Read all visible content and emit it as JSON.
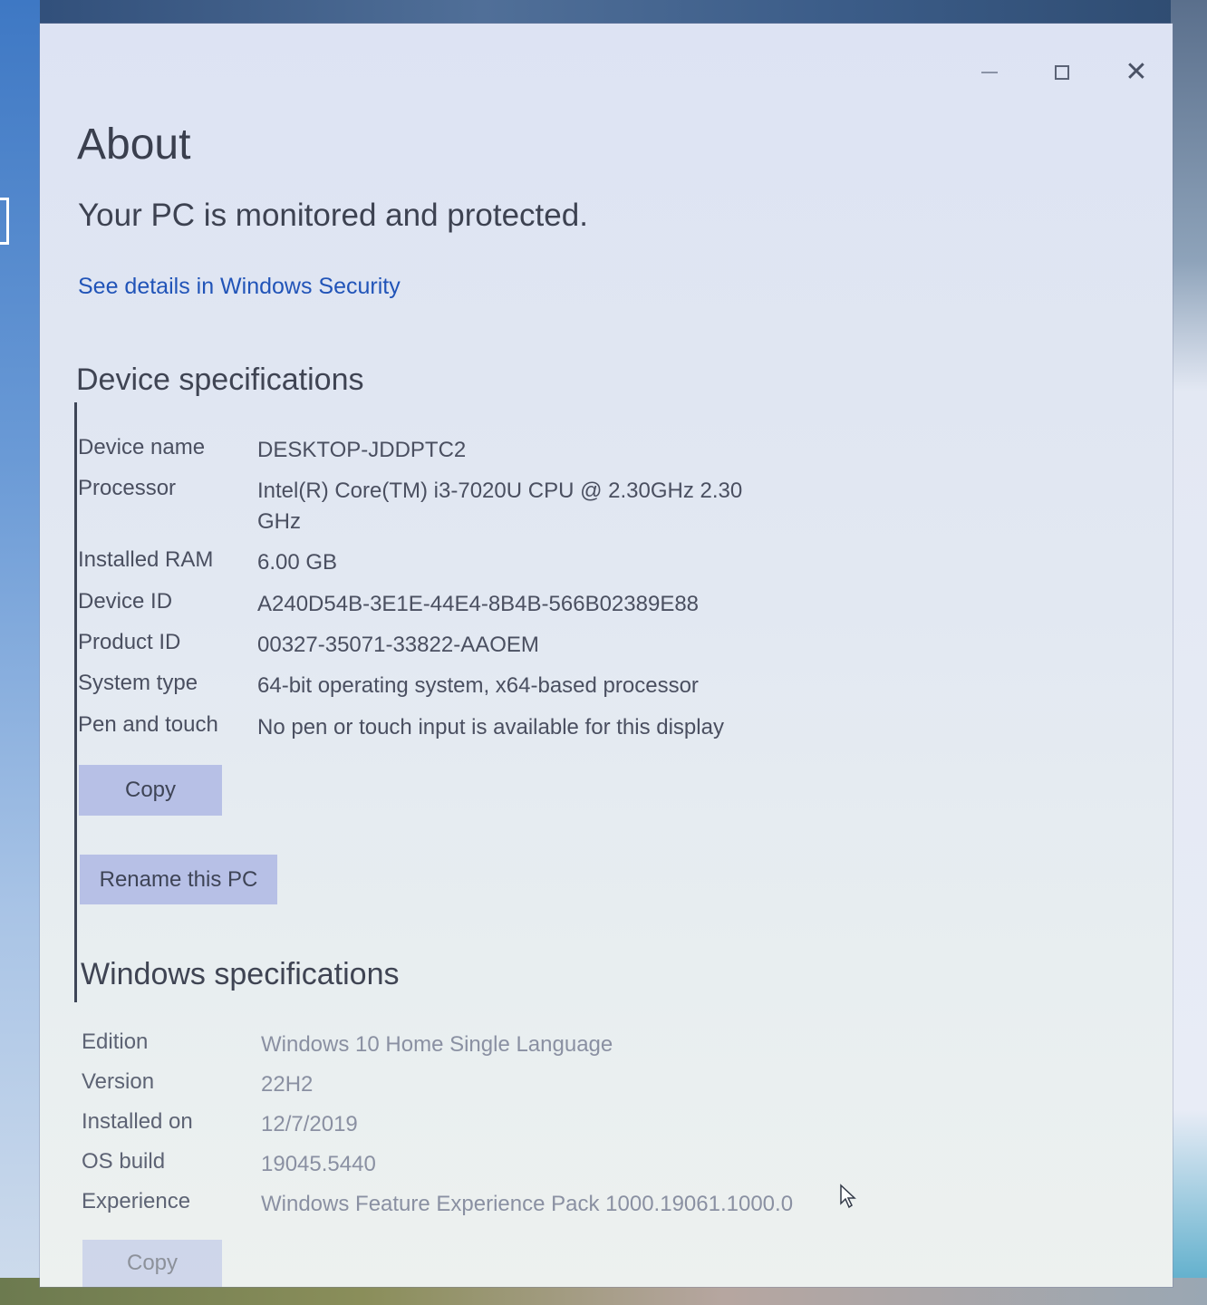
{
  "window": {
    "title": "About",
    "controls": {
      "minimize_icon": "minimize-icon",
      "maximize_icon": "maximize-icon",
      "close_icon": "close-icon",
      "close_glyph": "✕"
    }
  },
  "security": {
    "status": "Your PC is monitored and protected.",
    "link": "See details in Windows Security"
  },
  "device_specs": {
    "heading": "Device specifications",
    "rows": [
      {
        "label": "Device name",
        "value": "DESKTOP-JDDPTC2"
      },
      {
        "label": "Processor",
        "value": "Intel(R) Core(TM) i3-7020U CPU @ 2.30GHz   2.30 GHz"
      },
      {
        "label": "Installed RAM",
        "value": "6.00 GB"
      },
      {
        "label": "Device ID",
        "value": "A240D54B-3E1E-44E4-8B4B-566B02389E88"
      },
      {
        "label": "Product ID",
        "value": "00327-35071-33822-AAOEM"
      },
      {
        "label": "System type",
        "value": "64-bit operating system, x64-based processor"
      },
      {
        "label": "Pen and touch",
        "value": "No pen or touch input is available for this display"
      }
    ],
    "copy_button": "Copy",
    "rename_button": "Rename this PC"
  },
  "windows_specs": {
    "heading": "Windows specifications",
    "rows": [
      {
        "label": "Edition",
        "value": "Windows 10 Home Single Language"
      },
      {
        "label": "Version",
        "value": "22H2"
      },
      {
        "label": "Installed on",
        "value": "12/7/2019"
      },
      {
        "label": "OS build",
        "value": "19045.5440"
      },
      {
        "label": "Experience",
        "value": "Windows Feature Experience Pack 1000.19061.1000.0"
      }
    ],
    "copy_button": "Copy"
  },
  "colors": {
    "window_bg": "#e2e8f2",
    "link": "#2154b8",
    "button_bg": "#b7c0e6",
    "text": "#3d4251"
  }
}
